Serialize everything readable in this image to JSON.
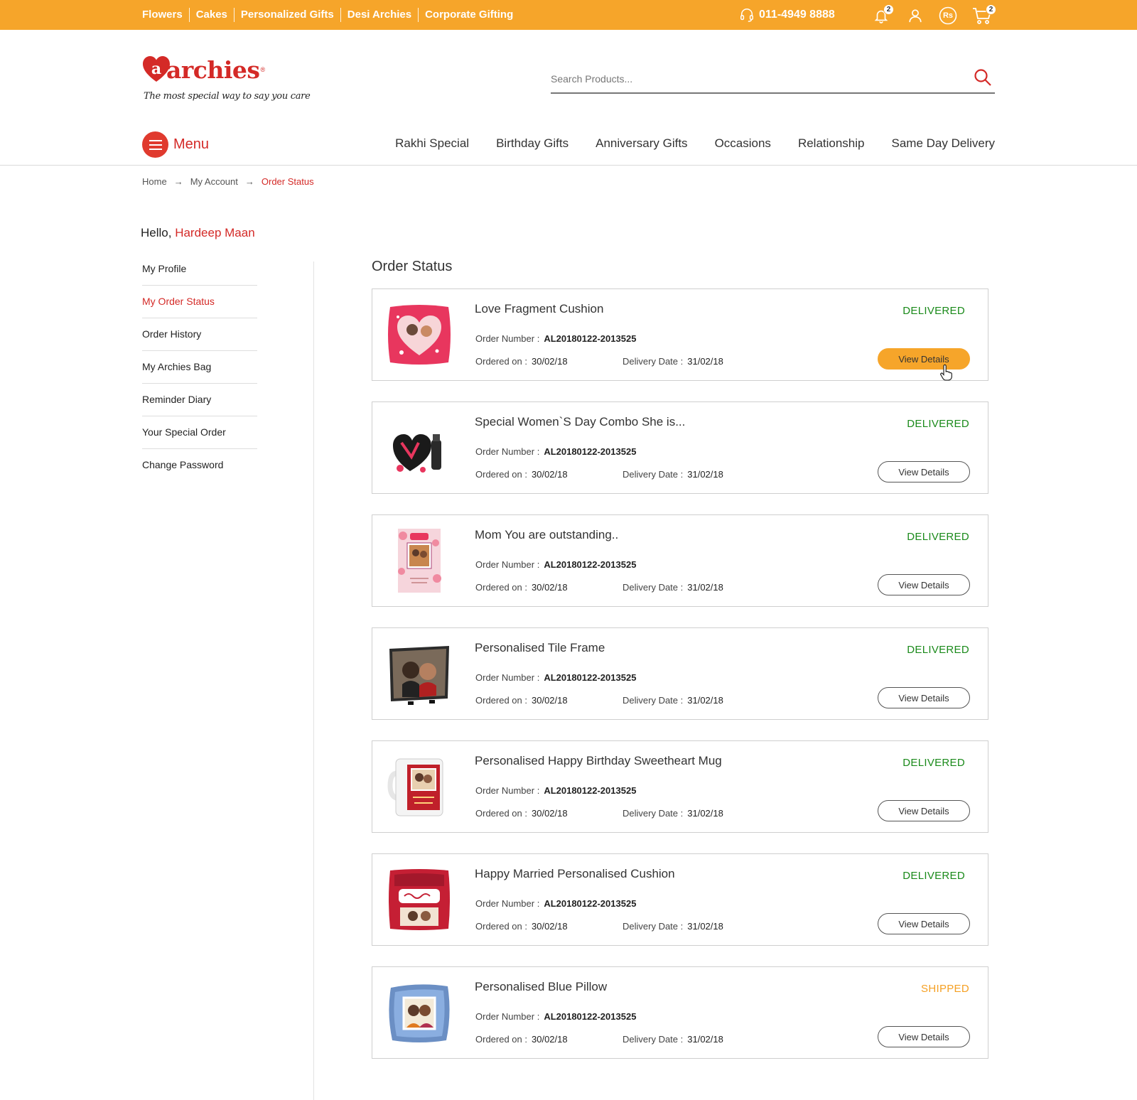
{
  "topbar": {
    "links": [
      "Flowers",
      "Cakes",
      "Personalized Gifts",
      "Desi Archies",
      "Corporate Gifting"
    ],
    "phone": "011-4949 8888",
    "notifications_count": "2",
    "cart_count": "2",
    "currency_symbol": "Rs",
    "bar_color": "#f6a52a"
  },
  "logo": {
    "brand": "archies",
    "tagline": "The most special way to say you care"
  },
  "search": {
    "placeholder": "Search Products..."
  },
  "menu_label": "Menu",
  "nav": [
    "Rakhi Special",
    "Birthday Gifts",
    "Anniversary Gifts",
    "Occasions",
    "Relationship",
    "Same Day Delivery"
  ],
  "breadcrumb": {
    "home": "Home",
    "account": "My Account",
    "current": "Order Status"
  },
  "user": {
    "greeting": "Hello,",
    "name": "Hardeep Maan"
  },
  "sidebar": [
    "My Profile",
    "My Order Status",
    "Order History",
    "My Archies Bag",
    "Reminder Diary",
    "Your Special Order",
    "Change Password"
  ],
  "page_title": "Order Status",
  "labels": {
    "order_number": "Order Number :",
    "ordered_on": "Ordered on :",
    "delivery_date": "Delivery Date :",
    "view_details": "View Details"
  },
  "orders": [
    {
      "name": "Love Fragment Cushion",
      "status": "DELIVERED",
      "order_number": "AL20180122-2013525",
      "ordered_on": "30/02/18",
      "delivery_date": "31/02/18",
      "thumb_icon": "cushion-heart-icon"
    },
    {
      "name": "Special Women`S Day Combo She is...",
      "status": "DELIVERED",
      "order_number": "AL20180122-2013525",
      "ordered_on": "30/02/18",
      "delivery_date": "31/02/18",
      "thumb_icon": "gift-combo-icon"
    },
    {
      "name": "Mom You are outstanding..",
      "status": "DELIVERED",
      "order_number": "AL20180122-2013525",
      "ordered_on": "30/02/18",
      "delivery_date": "31/02/18",
      "thumb_icon": "card-icon"
    },
    {
      "name": "Personalised Tile Frame",
      "status": "DELIVERED",
      "order_number": "AL20180122-2013525",
      "ordered_on": "30/02/18",
      "delivery_date": "31/02/18",
      "thumb_icon": "photo-frame-icon"
    },
    {
      "name": "Personalised Happy Birthday Sweetheart Mug",
      "status": "DELIVERED",
      "order_number": "AL20180122-2013525",
      "ordered_on": "30/02/18",
      "delivery_date": "31/02/18",
      "thumb_icon": "mug-icon"
    },
    {
      "name": "Happy Married Personalised Cushion",
      "status": "DELIVERED",
      "order_number": "AL20180122-2013525",
      "ordered_on": "30/02/18",
      "delivery_date": "31/02/18",
      "thumb_icon": "cushion-icon"
    },
    {
      "name": "Personalised Blue Pillow",
      "status": "SHIPPED",
      "order_number": "AL20180122-2013525",
      "ordered_on": "30/02/18",
      "delivery_date": "31/02/18",
      "thumb_icon": "pillow-icon"
    }
  ],
  "colors": {
    "accent": "#d42a27",
    "delivered": "#1a8a1a",
    "shipped": "#f5a023",
    "button_primary": "#f6a52a"
  }
}
